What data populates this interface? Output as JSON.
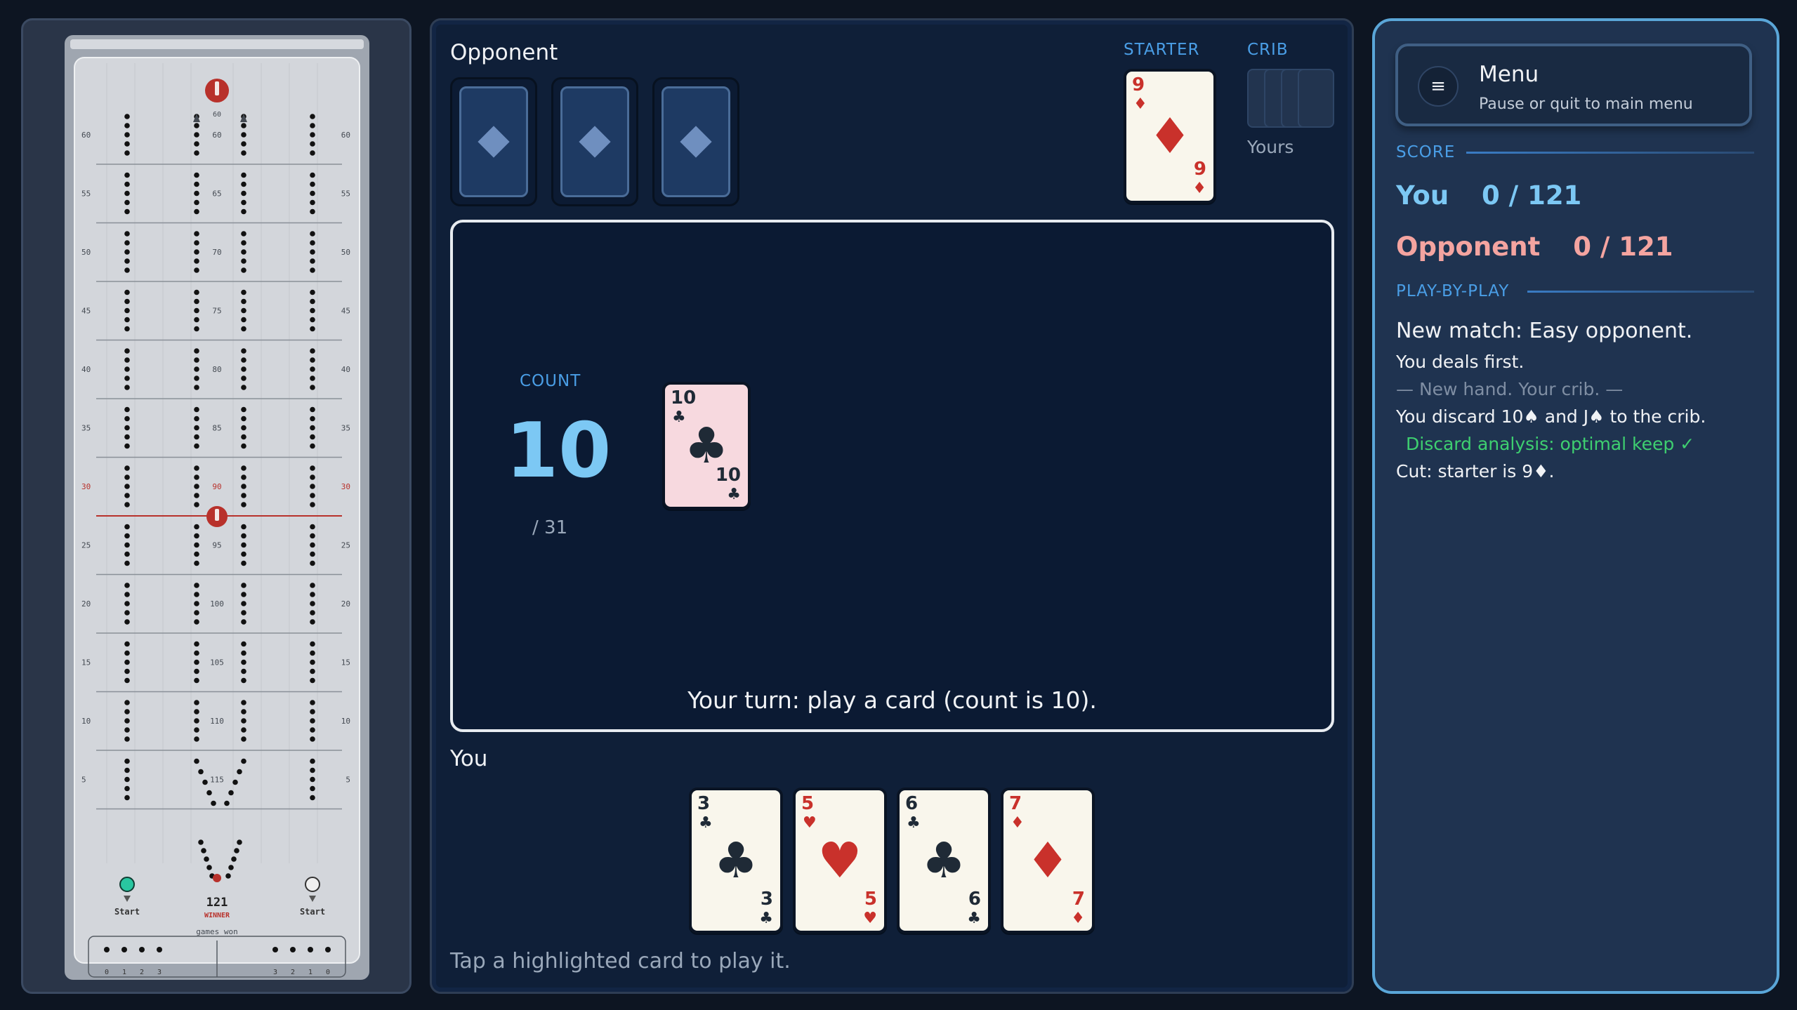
{
  "board": {
    "left_numbers": [
      "60",
      "55",
      "50",
      "45",
      "40",
      "35",
      "30",
      "25",
      "20",
      "15",
      "10",
      "5"
    ],
    "center_numbers": [
      "60",
      "65",
      "70",
      "75",
      "80",
      "85",
      "90",
      "95",
      "100",
      "105",
      "110",
      "115"
    ],
    "start_label_left": "Start",
    "start_label_right": "Start",
    "finish_number": "121",
    "winner_label": "WINNER",
    "games_won_label": "games won",
    "games_won_left": [
      "0",
      "1",
      "2",
      "3"
    ],
    "games_won_right": [
      "3",
      "2",
      "1",
      "0"
    ],
    "colors": {
      "peg_player": "#29c6a0",
      "peg_opponent": "#f0f0f0",
      "peg_marker": "#b8312b",
      "hole": "#111111"
    }
  },
  "opponent": {
    "label": "Opponent",
    "hand_count": 3
  },
  "starter": {
    "label": "STARTER",
    "card": {
      "rank": "9",
      "suit": "♦",
      "color": "red"
    }
  },
  "crib": {
    "label": "CRIB",
    "owner": "Yours"
  },
  "play": {
    "count_label": "COUNT",
    "count": "10",
    "count_max": "/ 31",
    "played_cards": [
      {
        "rank": "10",
        "suit": "♣",
        "color": "black"
      }
    ],
    "turn_message": "Your turn: play a card (count is 10)."
  },
  "you": {
    "label": "You",
    "hand": [
      {
        "rank": "3",
        "suit": "♣",
        "color": "black"
      },
      {
        "rank": "5",
        "suit": "♥",
        "color": "red"
      },
      {
        "rank": "6",
        "suit": "♣",
        "color": "black"
      },
      {
        "rank": "7",
        "suit": "♦",
        "color": "red"
      }
    ],
    "hint": "Tap a highlighted card to play it."
  },
  "side": {
    "menu": {
      "icon": "hamburger-icon",
      "title": "Menu",
      "subtitle": "Pause or quit to main menu"
    },
    "score_label": "SCORE",
    "scores": [
      {
        "name": "You",
        "value": "0 / 121"
      },
      {
        "name": "Opponent",
        "value": "0 / 121"
      }
    ],
    "log_label": "PLAY-BY-PLAY",
    "log": [
      {
        "text": "New match: Easy opponent.",
        "style": "big"
      },
      {
        "text": "You deals first.",
        "style": "normal"
      },
      {
        "text": "— New hand. Your crib. —",
        "style": "muted"
      },
      {
        "text": "You discard 10♠ and J♠ to the crib.",
        "style": "normal"
      },
      {
        "text": "Discard analysis: optimal keep ✓",
        "style": "good"
      },
      {
        "text": "Cut: starter is 9♦.",
        "style": "normal"
      }
    ]
  }
}
